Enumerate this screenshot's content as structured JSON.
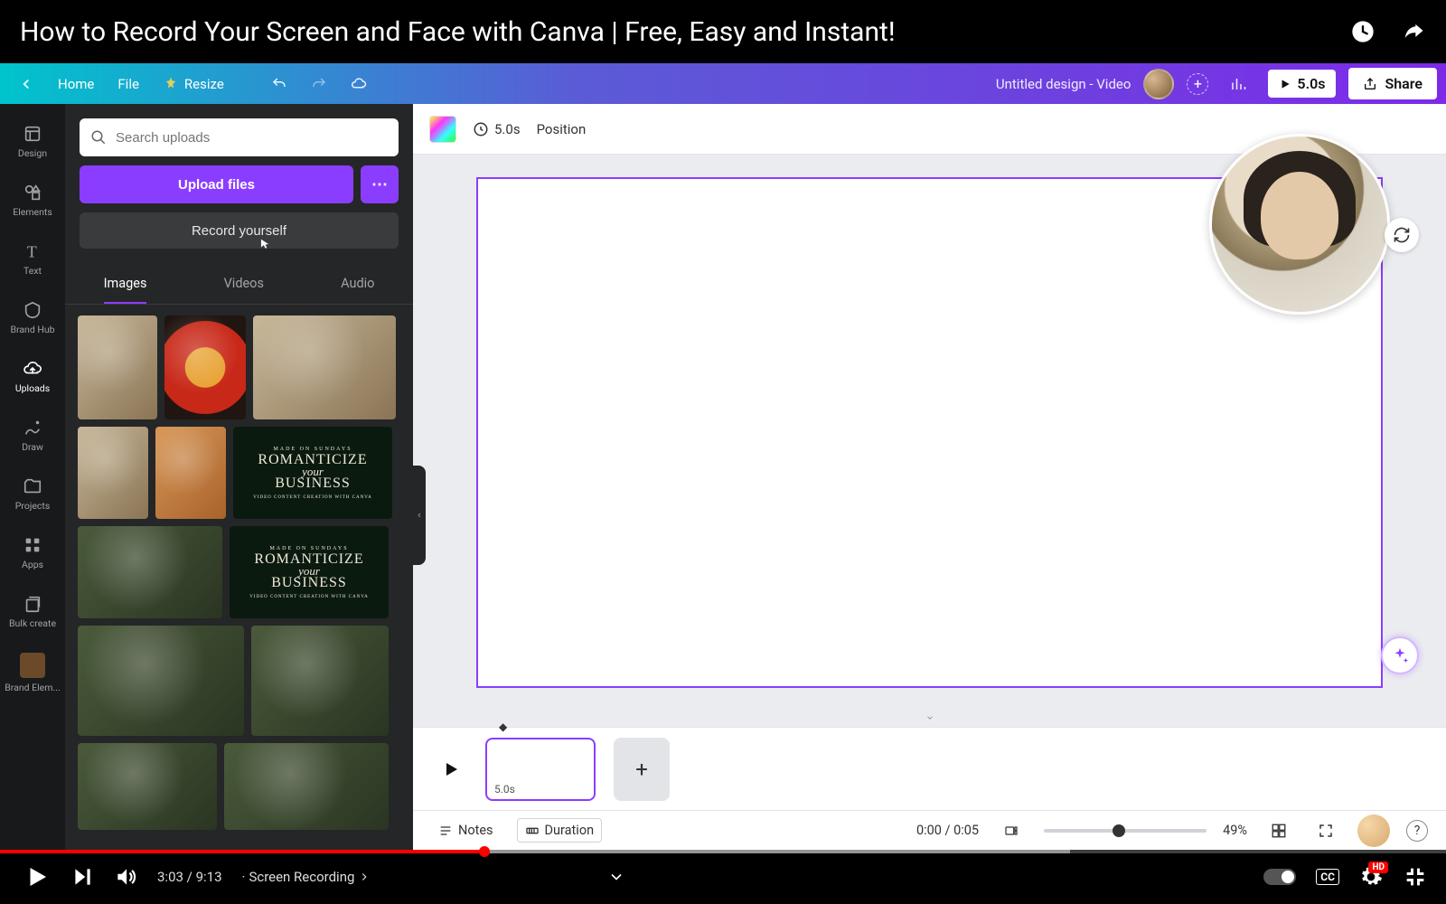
{
  "title_bar": {
    "title": "How to Record Your Screen and Face with Canva | Free, Easy and Instant!"
  },
  "canva_header": {
    "home": "Home",
    "file": "File",
    "resize": "Resize",
    "doc_title": "Untitled design - Video",
    "play_duration": "5.0s",
    "share": "Share"
  },
  "rail": [
    {
      "id": "design",
      "label": "Design"
    },
    {
      "id": "elements",
      "label": "Elements"
    },
    {
      "id": "text",
      "label": "Text"
    },
    {
      "id": "brandhub",
      "label": "Brand Hub"
    },
    {
      "id": "uploads",
      "label": "Uploads"
    },
    {
      "id": "draw",
      "label": "Draw"
    },
    {
      "id": "projects",
      "label": "Projects"
    },
    {
      "id": "apps",
      "label": "Apps"
    },
    {
      "id": "bulk",
      "label": "Bulk create"
    },
    {
      "id": "brandelem",
      "label": "Brand Elem..."
    }
  ],
  "panel": {
    "search_placeholder": "Search uploads",
    "upload": "Upload files",
    "record": "Record yourself",
    "tabs": {
      "images": "Images",
      "videos": "Videos",
      "audio": "Audio"
    },
    "romanticize": {
      "top": "MADE ON SUNDAYS",
      "l1": "ROMANTICIZE",
      "l2": "your",
      "l3": "BUSINESS",
      "sub": "VIDEO CONTENT CREATION WITH CANVA"
    }
  },
  "context_bar": {
    "timing": "5.0s",
    "position": "Position"
  },
  "timeline": {
    "clip_duration": "5.0s"
  },
  "status": {
    "notes": "Notes",
    "duration": "Duration",
    "time": "0:00 / 0:05",
    "zoom": "49%"
  },
  "youtube": {
    "current": "3:03",
    "total": "9:13",
    "sep": " / ",
    "chapter_prefix": " · ",
    "chapter": "Screen Recording"
  }
}
